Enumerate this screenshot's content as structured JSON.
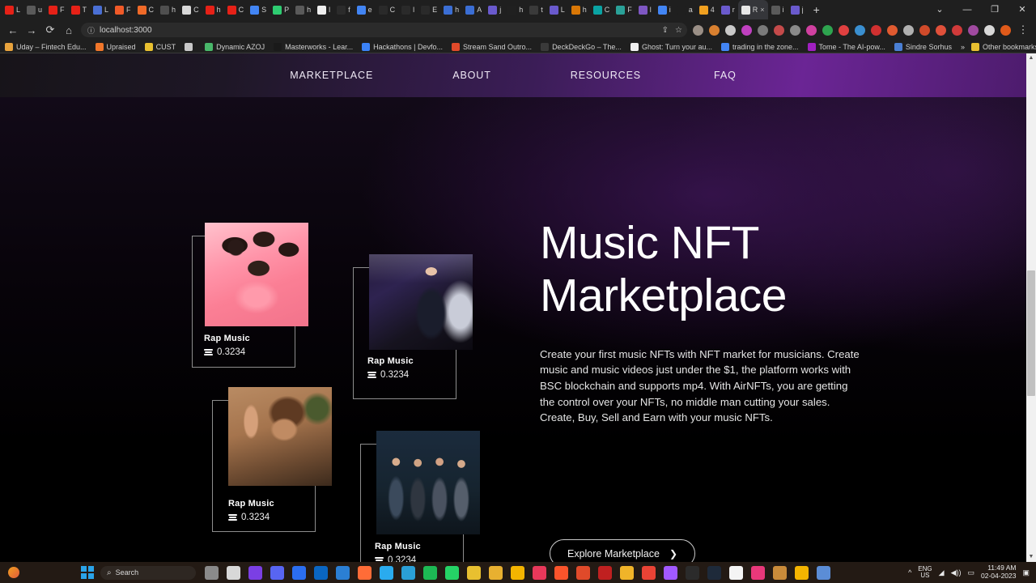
{
  "browser": {
    "tabs": [
      {
        "label": "L",
        "color": "#e62117"
      },
      {
        "label": "u",
        "color": "#5a5a5a"
      },
      {
        "label": "F",
        "color": "#e62117"
      },
      {
        "label": "T",
        "color": "#e62117"
      },
      {
        "label": "L",
        "color": "#4a6fd4"
      },
      {
        "label": "F",
        "color": "#f05a28"
      },
      {
        "label": "C",
        "color": "#f06a28"
      },
      {
        "label": "h",
        "color": "#4f4f4f"
      },
      {
        "label": "C",
        "color": "#d8d8d8"
      },
      {
        "label": "h",
        "color": "#e62117"
      },
      {
        "label": "C",
        "color": "#e62117"
      },
      {
        "label": "S",
        "color": "#4285f4"
      },
      {
        "label": "P",
        "color": "#2ecc71"
      },
      {
        "label": "h",
        "color": "#5a5a5a"
      },
      {
        "label": "l",
        "color": "#efefef"
      },
      {
        "label": "f",
        "color": "#2b2b2b"
      },
      {
        "label": "e",
        "color": "#4285f4"
      },
      {
        "label": "C",
        "color": "#2a2a2a"
      },
      {
        "label": "l",
        "color": "#2a2a2a"
      },
      {
        "label": "E",
        "color": "#2a2a2a"
      },
      {
        "label": "h",
        "color": "#3b6ed4"
      },
      {
        "label": "A",
        "color": "#3b6ed4"
      },
      {
        "label": "j",
        "color": "#6a5acd"
      },
      {
        "label": "h",
        "color": "#202020"
      },
      {
        "label": "t",
        "color": "#3a3a3a"
      },
      {
        "label": "L",
        "color": "#6a5acd"
      },
      {
        "label": "h",
        "color": "#d97706"
      },
      {
        "label": "C",
        "color": "#0aa3a3"
      },
      {
        "label": "F",
        "color": "#2aa198"
      },
      {
        "label": "l",
        "color": "#7e57c2"
      },
      {
        "label": "i",
        "color": "#4285f4"
      },
      {
        "label": "a",
        "color": "#1f1f1f"
      },
      {
        "label": "4",
        "color": "#f0a020"
      },
      {
        "label": "r",
        "color": "#6a5acd"
      },
      {
        "label": "R",
        "color": "#e8e8e8",
        "active": true
      },
      {
        "label": "i",
        "color": "#5a5a5a"
      },
      {
        "label": "j",
        "color": "#6a5acd"
      }
    ],
    "new_tab": "+",
    "window_controls": [
      "⌄",
      "—",
      "❐",
      "✕"
    ],
    "nav": {
      "back": "←",
      "forward": "→",
      "reload": "⟳",
      "home": "⌂"
    },
    "omnibox": {
      "security_icon": "ⓘ",
      "url": "localhost:3000",
      "share": "⇪",
      "star": "☆"
    },
    "extension_colors": [
      "#9a8f86",
      "#d98030",
      "#c9c9c9",
      "#c040c0",
      "#7a7a7a",
      "#c44a4a",
      "#8a8a8a",
      "#d040a0",
      "#2ea44f",
      "#e04040",
      "#3a8fd0",
      "#d03030",
      "#e05a30",
      "#b0b0b0",
      "#d04a2a",
      "#e0503a",
      "#d03a3a",
      "#a04aa0",
      "#d8d8d8",
      "#e05a1a"
    ],
    "menu_icon": "⋮",
    "bookmarks": [
      {
        "label": "Uday – Fintech Edu...",
        "color": "#e8a33d"
      },
      {
        "label": "Upraised",
        "color": "#f0762a"
      },
      {
        "label": "CUST",
        "color": "#e8c030"
      },
      {
        "label": "",
        "color": "#c8c8c8"
      },
      {
        "label": "Dynamic AZOJ",
        "color": "#49b86a"
      },
      {
        "label": "Masterworks - Lear...",
        "color": "#1a1a1a"
      },
      {
        "label": "Hackathons | Devfo...",
        "color": "#3b82f6"
      },
      {
        "label": "Stream Sand Outro...",
        "color": "#e04a2a"
      },
      {
        "label": "DeckDeckGo – The...",
        "color": "#3a3a3a"
      },
      {
        "label": "Ghost: Turn your au...",
        "color": "#efefef"
      },
      {
        "label": "trading in the zone...",
        "color": "#4285f4"
      },
      {
        "label": "Tome - The AI-pow...",
        "color": "#a020c0"
      },
      {
        "label": "Sindre Sorhus",
        "color": "#4a7fd4"
      }
    ],
    "bookmarks_overflow": "»",
    "other_bookmarks": {
      "label": "Other bookmarks",
      "color": "#e8c030"
    }
  },
  "site": {
    "nav_items": [
      {
        "label": "MARKETPLACE"
      },
      {
        "label": "ABOUT"
      },
      {
        "label": "RESOURCES"
      },
      {
        "label": "FAQ"
      }
    ],
    "hero": {
      "title_line1": "Music NFT",
      "title_line2": "Marketplace",
      "paragraph": "Create your first music NFTs with NFT market for musicians. Create music and music videos just under the $1, the platform works with BSC blockchain and supports mp4. With AirNFTs, you are getting the control over your NFTs, no middle man cutting your sales. Create, Buy, Sell and Earn with your music NFTs.",
      "cta_label": "Explore Marketplace",
      "cta_chevron": "❯"
    },
    "cards": [
      {
        "title": "Rap Music",
        "price": "0.3234",
        "art": "img-a",
        "alt": "four-people-in-pink-robes-photo"
      },
      {
        "title": "Rap Music",
        "price": "0.3234",
        "art": "img-b",
        "alt": "man-in-suit-on-stage-photo"
      },
      {
        "title": "Rap Music",
        "price": "0.3234",
        "art": "img-c",
        "alt": "portrait-person-outdoors-photo"
      },
      {
        "title": "Rap Music",
        "price": "0.3234",
        "art": "img-d",
        "alt": "four-men-band-photo"
      }
    ],
    "colors": {
      "accent_purple": "#6b2595",
      "nav_dark": "#171419",
      "background": "#000000",
      "text": "#ffffff"
    }
  },
  "taskbar": {
    "search_placeholder": "Search",
    "search_icon": "⌕",
    "apps": [
      {
        "name": "task-view",
        "color": "#8a8a8a"
      },
      {
        "name": "paint",
        "color": "#d8d8d8"
      },
      {
        "name": "upraised",
        "color": "#7b3fe4"
      },
      {
        "name": "discord",
        "color": "#5865f2"
      },
      {
        "name": "wondershare",
        "color": "#2b6ef0"
      },
      {
        "name": "outlook",
        "color": "#0a66c2"
      },
      {
        "name": "vscode",
        "color": "#2b7fd4"
      },
      {
        "name": "postman",
        "color": "#ff6c37"
      },
      {
        "name": "telegram",
        "color": "#2aabee"
      },
      {
        "name": "edge",
        "color": "#2a9fd6"
      },
      {
        "name": "spotify",
        "color": "#1db954"
      },
      {
        "name": "whatsapp",
        "color": "#25d366"
      },
      {
        "name": "store",
        "color": "#e8c030"
      },
      {
        "name": "files",
        "color": "#e8b030"
      },
      {
        "name": "chrome",
        "color": "#f4b400"
      },
      {
        "name": "music",
        "color": "#e8385a"
      },
      {
        "name": "brave",
        "color": "#fb542b"
      },
      {
        "name": "mongodb",
        "color": "#e04a2a"
      },
      {
        "name": "app-red",
        "color": "#c02020"
      },
      {
        "name": "s-app",
        "color": "#f0b429"
      },
      {
        "name": "gmail",
        "color": "#ea4335"
      },
      {
        "name": "figma",
        "color": "#a259ff"
      },
      {
        "name": "terminal",
        "color": "#2b2b2b"
      },
      {
        "name": "tradingview",
        "color": "#1e2a3a"
      },
      {
        "name": "notion",
        "color": "#f4f4f4"
      },
      {
        "name": "app-pink",
        "color": "#e8387a"
      },
      {
        "name": "crypto",
        "color": "#c98b3a"
      },
      {
        "name": "chrome-2",
        "color": "#f4b400"
      },
      {
        "name": "snipping-tool",
        "color": "#5b8dd6"
      }
    ],
    "tray": {
      "chevron": "^",
      "lang_line1": "ENG",
      "lang_line2": "US",
      "wifi_icon": "◥",
      "volume_icon": "🔊",
      "battery_icon": "▭",
      "time": "11:49 AM",
      "date": "02-04-2023",
      "notification_icon": "🗨"
    }
  }
}
